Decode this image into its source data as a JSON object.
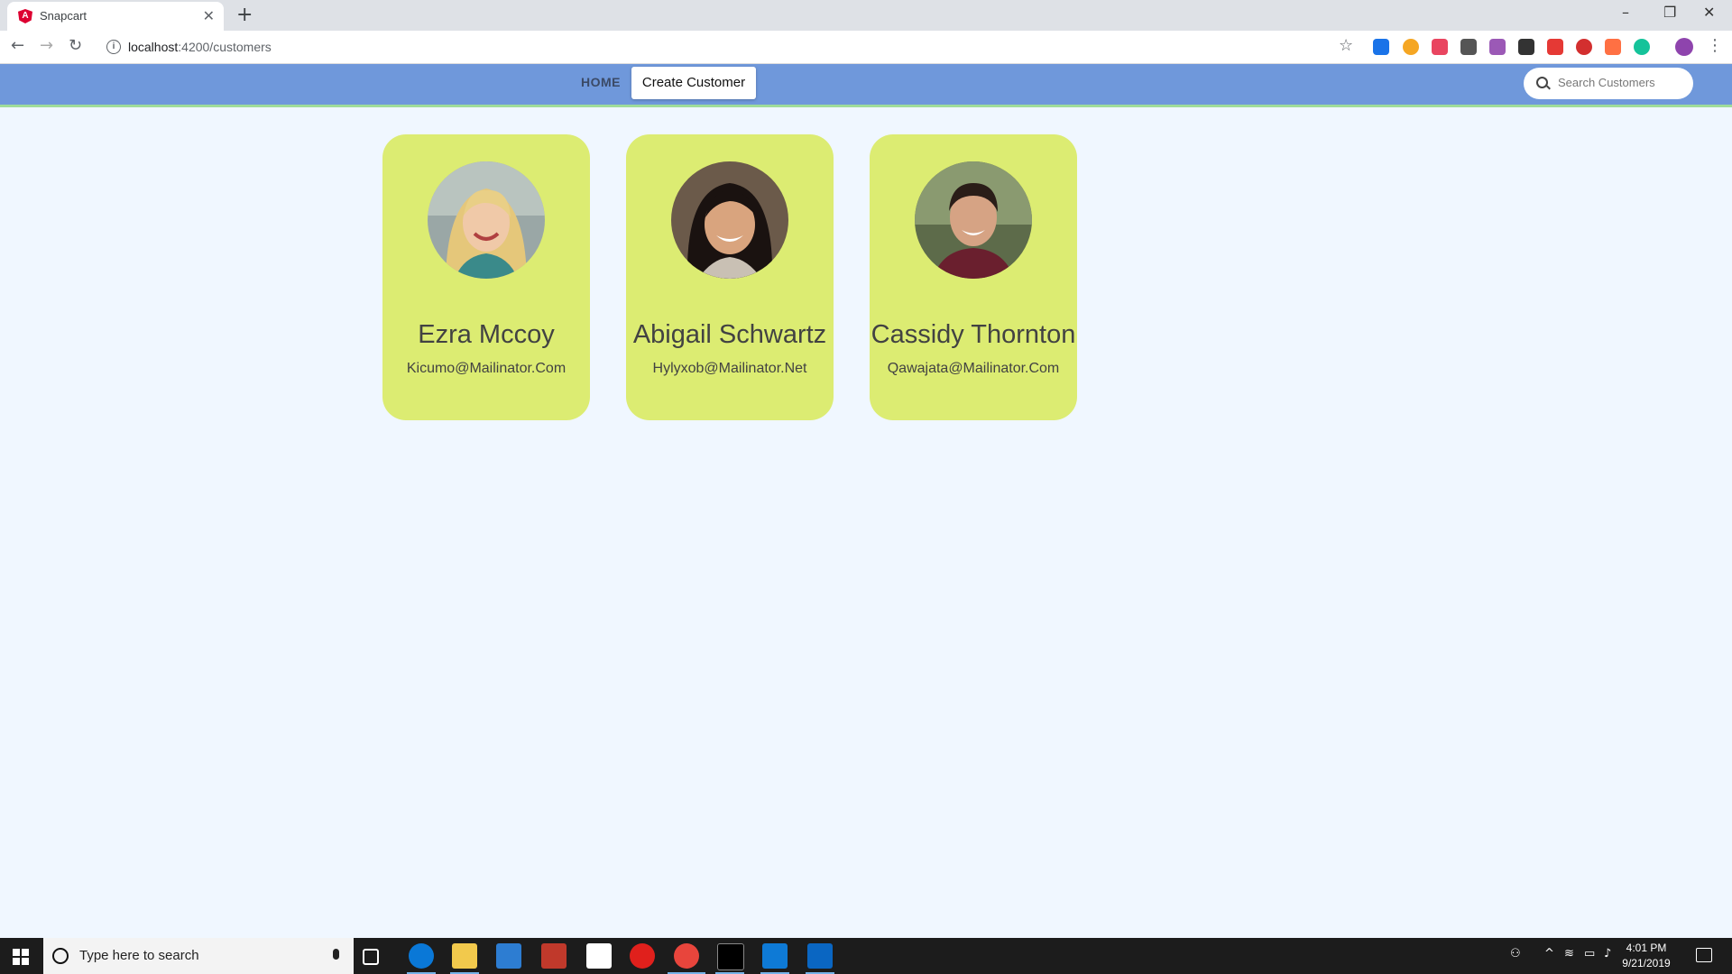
{
  "browser": {
    "tab_title": "Snapcart",
    "url_host": "localhost",
    "url_path": ":4200/customers"
  },
  "nav": {
    "home_label": "HOME",
    "create_label": "Create Customer",
    "search_placeholder": "Search Customers"
  },
  "customers": [
    {
      "name": "Ezra Mccoy",
      "email": "Kicumo@Mailinator.Com"
    },
    {
      "name": "Abigail Schwartz",
      "email": "Hylyxob@Mailinator.Net"
    },
    {
      "name": "Cassidy Thornton",
      "email": "Qawajata@Mailinator.Com"
    }
  ],
  "taskbar": {
    "search_placeholder": "Type here to search",
    "time": "4:01 PM",
    "date": "9/21/2019"
  },
  "colors": {
    "navbar": "#6f98db",
    "card": "#dcec72",
    "page_bg": "#f0f7ff"
  }
}
